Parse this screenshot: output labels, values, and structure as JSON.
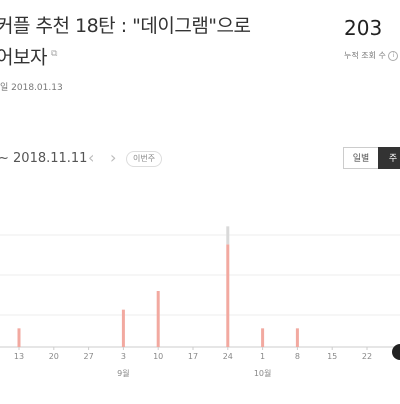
{
  "post": {
    "title_line1": "커플 추천 18탄 : \"데이그램\"으로",
    "title_line2": "어보자",
    "date": "일 2018.01.13"
  },
  "stats": {
    "views": "203",
    "views_label": "누적 조회 수"
  },
  "controls": {
    "date_range": "~ 2018.11.11",
    "prev_icon": "chevron-left-icon",
    "next_icon": "chevron-right-icon",
    "this_week": "이번주",
    "daily": "일별",
    "weekly": "주"
  },
  "colors": {
    "bar": "#f2a9a0",
    "bar_highlight": "#d9d9d9",
    "axis": "#cccccc"
  },
  "chart_data": {
    "type": "bar",
    "x": [
      "13",
      "20",
      "27",
      "3",
      "10",
      "17",
      "24",
      "1",
      "8",
      "15",
      "22"
    ],
    "months": [
      {
        "label": "9월",
        "at": "3"
      },
      {
        "label": "10월",
        "at": "1"
      }
    ],
    "values": [
      2,
      0,
      0,
      4,
      6,
      0,
      11,
      2,
      2,
      0,
      0
    ],
    "highlight": [
      0,
      0,
      0,
      0,
      0,
      0,
      1,
      0,
      0,
      0,
      0
    ],
    "ylim": [
      0,
      12
    ]
  }
}
